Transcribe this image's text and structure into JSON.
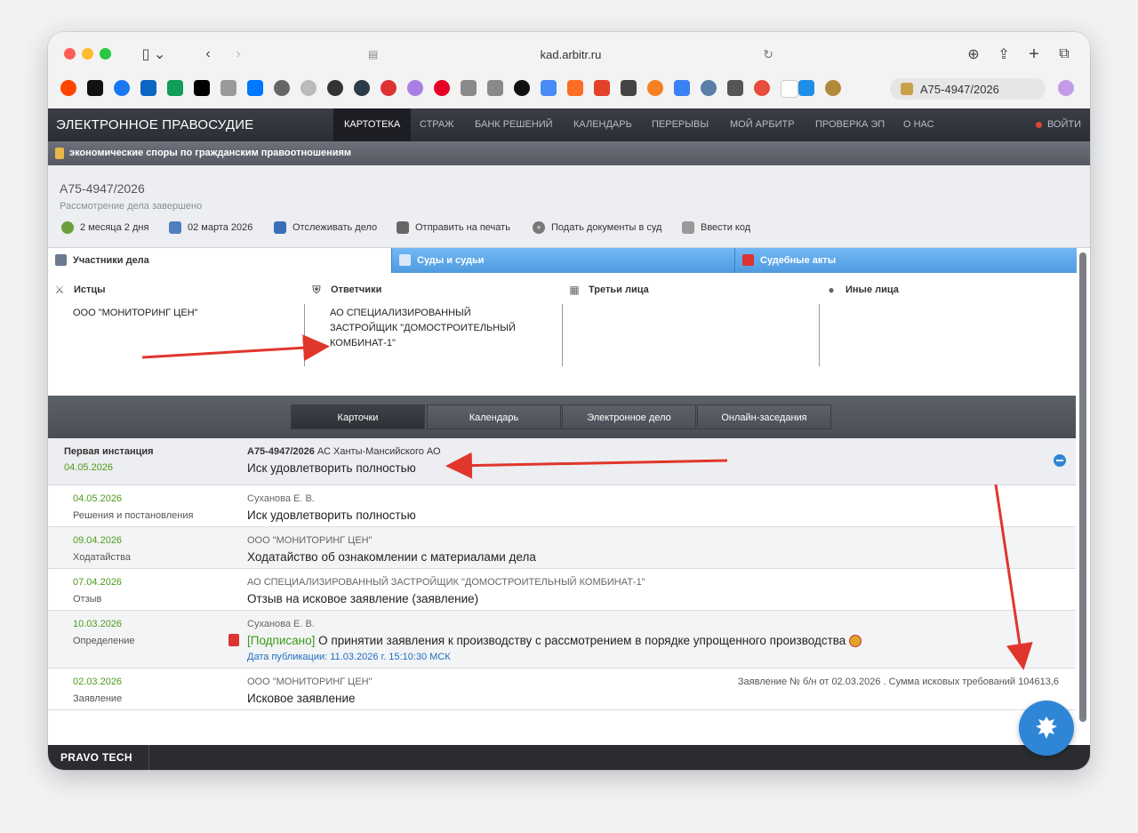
{
  "browser": {
    "url": "kad.arbitr.ru",
    "tab_title": "A75-4947/2026"
  },
  "site": {
    "brand": "ЭЛЕКТРОННОЕ ПРАВОСУДИЕ",
    "nav": [
      "КАРТОТЕКА",
      "СТРАЖ",
      "БАНК РЕШЕНИЙ",
      "КАЛЕНДАРЬ",
      "ПЕРЕРЫВЫ",
      "МОЙ АРБИТР",
      "ПРОВЕРКА ЭП",
      "О НАС"
    ],
    "login": "ВОЙТИ",
    "category": "экономические споры по гражданским правоотношениям"
  },
  "case": {
    "number": "А75-4947/2026",
    "status": "Рассмотрение дела завершено",
    "actions": {
      "duration": "2 месяца 2 дня",
      "date": "02 марта 2026",
      "track": "Отслеживать дело",
      "print": "Отправить на печать",
      "submit": "Подать документы в суд",
      "code": "Ввести код"
    }
  },
  "tabs": {
    "participants": "Участники дела",
    "courts": "Суды и судьи",
    "acts": "Судебные акты"
  },
  "parties": {
    "plaintiffs": {
      "title": "Истцы",
      "value": "ООО \"МОНИТОРИНГ ЦЕН\""
    },
    "defendants": {
      "title": "Ответчики",
      "value": "АО СПЕЦИАЛИЗИРОВАННЫЙ ЗАСТРОЙЩИК \"ДОМОСТРОИТЕЛЬНЫЙ КОМБИНАТ-1\""
    },
    "third": {
      "title": "Третьи лица",
      "value": ""
    },
    "other": {
      "title": "Иные лица",
      "value": ""
    }
  },
  "subtabs": [
    "Карточки",
    "Календарь",
    "Электронное дело",
    "Онлайн-заседания"
  ],
  "instance": {
    "title": "Первая инстанция",
    "date": "04.05.2026",
    "case_bold": "А75-4947/2026",
    "court": " АС Ханты-Мансийского АО",
    "result": "Иск удовлетворить полностью"
  },
  "entries": [
    {
      "date": "04.05.2026",
      "type": "Решения и постановления",
      "who": "Суханова Е. В.",
      "text": "Иск удовлетворить полностью"
    },
    {
      "date": "09.04.2026",
      "type": "Ходатайства",
      "who": "ООО \"МОНИТОРИНГ ЦЕН\"",
      "text": "Ходатайство об ознакомлении с материалами дела"
    },
    {
      "date": "07.04.2026",
      "type": "Отзыв",
      "who": "АО СПЕЦИАЛИЗИРОВАННЫЙ ЗАСТРОЙЩИК \"ДОМОСТРОИТЕЛЬНЫЙ КОМБИНАТ-1\"",
      "text": "Отзыв на исковое заявление (заявление)"
    },
    {
      "date": "10.03.2026",
      "type": "Определение",
      "who": "Суханова Е. В.",
      "signed": "[Подписано]",
      "text": " О принятии заявления к производству с рассмотрением в порядке упрощенного производства",
      "pub": "Дата публикации: 11.03.2026 г. 15:10:30 МСК"
    },
    {
      "date": "02.03.2026",
      "type": "Заявление",
      "who": "ООО \"МОНИТОРИНГ ЦЕН\"",
      "text": "Исковое заявление",
      "extra": "Заявление № б/н от 02.03.2026 . Сумма исковых требований 104613,6"
    }
  ],
  "footer": {
    "brand": "PRAVO TECH"
  },
  "colors": {
    "accent_blue": "#4e9be0",
    "date_green": "#4e9a1a",
    "annotation_red": "#e0362c"
  }
}
